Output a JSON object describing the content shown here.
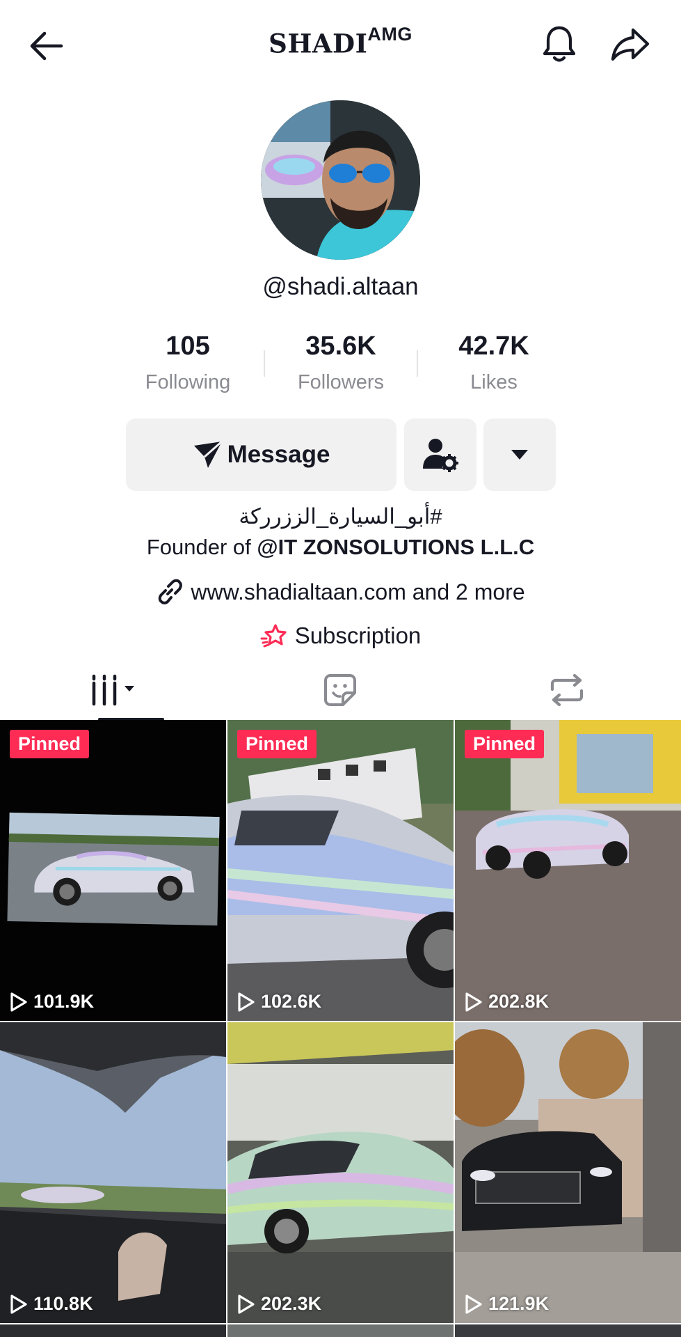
{
  "header": {
    "title": "SHADI",
    "title_superscript": "AMG",
    "back_icon": "back-arrow-icon",
    "notification_icon": "bell-icon",
    "share_icon": "share-icon"
  },
  "profile": {
    "handle": "@shadi.altaan",
    "stats": [
      {
        "value": "105",
        "label": "Following"
      },
      {
        "value": "35.6K",
        "label": "Followers"
      },
      {
        "value": "42.7K",
        "label": "Likes"
      }
    ],
    "message_label": "Message",
    "bio_line1": "#أبو_السيارة_الززرركة",
    "bio_line2_prefix": "Founder of ",
    "bio_line2_bold": "@IT ZONSOLUTIONS L.L.C",
    "link_text": "www.shadialtaan.com and 2 more",
    "subscription_label": "Subscription"
  },
  "tabs": [
    {
      "icon": "videos-grid-icon",
      "active": true
    },
    {
      "icon": "sticker-icon",
      "active": false
    },
    {
      "icon": "repost-icon",
      "active": false
    }
  ],
  "videos": [
    {
      "pinned": true,
      "pinned_label": "Pinned",
      "views": "101.9K"
    },
    {
      "pinned": true,
      "pinned_label": "Pinned",
      "views": "102.6K"
    },
    {
      "pinned": true,
      "pinned_label": "Pinned",
      "views": "202.8K"
    },
    {
      "pinned": false,
      "views": "110.8K"
    },
    {
      "pinned": false,
      "views": "202.3K"
    },
    {
      "pinned": false,
      "views": "121.9K"
    }
  ],
  "colors": {
    "accent": "#fe2c55",
    "text": "#161823",
    "muted": "#8a8b91",
    "button_bg": "#f1f1f2"
  }
}
